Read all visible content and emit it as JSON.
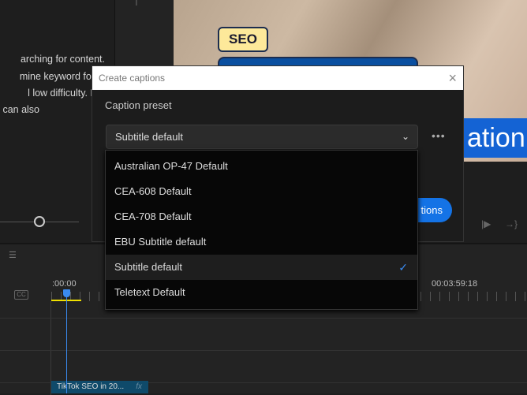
{
  "left_panel": {
    "text_lines": [
      "arching for content.",
      "mine keyword for",
      "l low difficulty. Plant",
      "u can also"
    ]
  },
  "video": {
    "badge": "SEO",
    "caption_fragment": "ation"
  },
  "dialog": {
    "title": "Create captions",
    "preset_label": "Caption preset",
    "selected_preset": "Subtitle default",
    "more_label": "•••",
    "create_button_fragment": "tions",
    "options": [
      {
        "label": "Australian OP-47 Default",
        "selected": false
      },
      {
        "label": "CEA-608 Default",
        "selected": false
      },
      {
        "label": "CEA-708 Default",
        "selected": false
      },
      {
        "label": "EBU Subtitle default",
        "selected": false
      },
      {
        "label": "Subtitle default",
        "selected": true
      },
      {
        "label": "Teletext Default",
        "selected": false
      }
    ]
  },
  "timeline": {
    "start_timecode": ":00:00",
    "end_timecode": "00:03:59:18",
    "cc_label": "CC",
    "clip_name": "TikTok SEO in 20...",
    "clip_fx": "fx"
  },
  "colors": {
    "accent": "#1473e6",
    "playhead": "#3a8af0",
    "work_area": "#f0e000",
    "clip": "#0f4a6a"
  }
}
